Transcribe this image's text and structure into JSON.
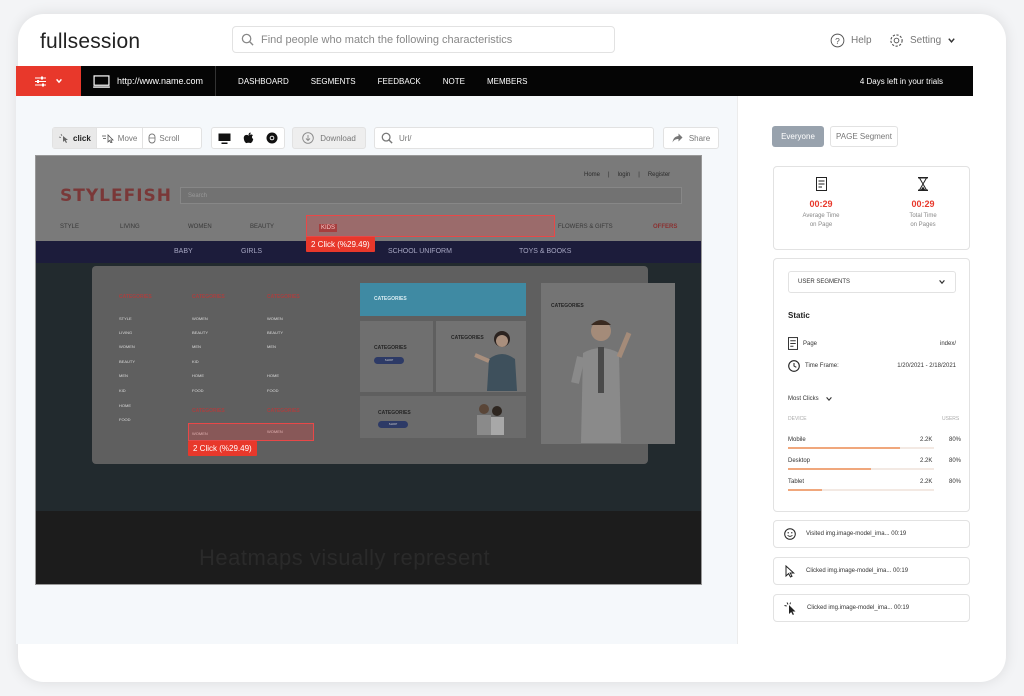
{
  "app": {
    "logo": "fullsession"
  },
  "header": {
    "search_placeholder": "Find people who match the following characteristics",
    "help_label": "Help",
    "setting_label": "Setting"
  },
  "navbar": {
    "url": "http://www.name.com",
    "links": [
      "DASHBOARD",
      "SEGMENTS",
      "FEEDBACK",
      "NOTE",
      "MEMBERS"
    ],
    "trial": "4 Days left in your trials"
  },
  "toolbar": {
    "click_label": "click",
    "move_label": "Move",
    "scroll_label": "Scroll",
    "download_label": "Download",
    "url_placeholder": "Url/",
    "share_label": "Share"
  },
  "heatmap": {
    "site_logo": "STYLEFISH",
    "site_search": "Search",
    "top_links": [
      "Home",
      "|",
      "login",
      "|",
      "Register"
    ],
    "main_nav": [
      "STYLE",
      "LIVING",
      "WOMEN",
      "BEAUTY",
      "KIDS",
      "FLOWERS & GIFTS",
      "OFFERS"
    ],
    "sub_nav": [
      "BABY",
      "GIRLS",
      "SCHOOL UNIFORM",
      "TOYS & BOOKS"
    ],
    "cat_heading": "CATEGORIES",
    "col1": [
      "STYLE",
      "LIVING",
      "WOMEN",
      "BEAUTY",
      "MEN",
      "KID",
      "HOME",
      "FOOD"
    ],
    "col2": [
      "WOMEN",
      "BEAUTY",
      "MEN",
      "KID",
      "HOME",
      "FOOD"
    ],
    "col3": [
      "WOMEN",
      "BEAUTY",
      "MEN",
      "HOME",
      "FOOD"
    ],
    "col2b": [
      "WOMEN"
    ],
    "col3b": [
      "WOMEN"
    ],
    "card_label": "CATEGORIES",
    "card_btn": "SHOP",
    "badge1": "2 Click (%29.49)",
    "badge2": "2 Click (%29.49)",
    "footer_text": "Heatmaps visually represent"
  },
  "right": {
    "tab_everyone": "Everyone",
    "tab_page_segment": "PAGE Segment",
    "avg_time_value": "00:29",
    "avg_time_label_1": "Average Time",
    "avg_time_label_2": "on Page",
    "total_time_value": "00:29",
    "total_time_label_1": "Total Time",
    "total_time_label_2": "on Pages",
    "user_segments": "USER SEGMENTS",
    "static_label": "Static",
    "page_label": "Page",
    "page_value": "index/",
    "time_frame_label": "Time Frame:",
    "time_frame_value": "1/20/2021 - 2/18/2021",
    "most_clicks": "Most Clicks",
    "device_col": "DEVICE",
    "users_col": "USERS",
    "devices": [
      {
        "name": "Mobile",
        "count": "2.2K",
        "pct": "80%",
        "fill": 0.77
      },
      {
        "name": "Desktop",
        "count": "2.2K",
        "pct": "80%",
        "fill": 0.57
      },
      {
        "name": "Tablet",
        "count": "2.2K",
        "pct": "80%",
        "fill": 0.23
      }
    ],
    "activities": [
      "Visited img.image-model_ima... 00:19",
      "Clicked img.image-model_ima... 00:19",
      "Clicked img.image-model_ima... 00:19"
    ]
  },
  "colors": {
    "accent": "#e8382b",
    "nav_bg": "#050505",
    "panel_bg": "#f5f8fb"
  }
}
